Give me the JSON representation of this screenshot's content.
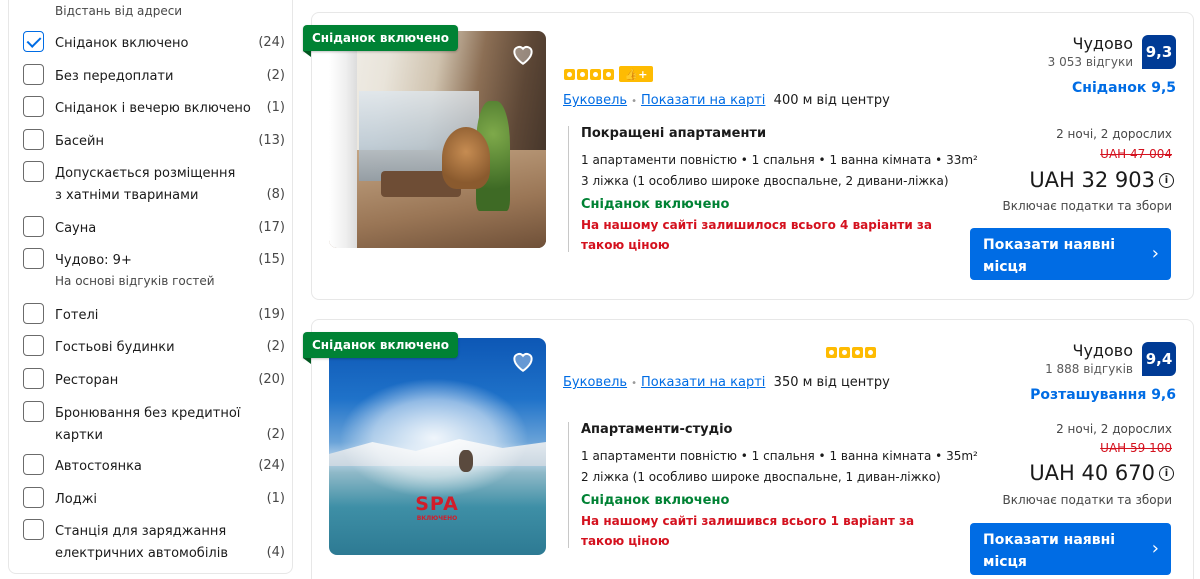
{
  "sidebar": {
    "header": "Відстань від адреси",
    "filters": [
      {
        "label": "Сніданок включено",
        "count": "(24)",
        "checked": true
      },
      {
        "label": "Без передоплати",
        "count": "(2)",
        "checked": false
      },
      {
        "label": "Сніданок і вечерю включено",
        "count": "(1)",
        "checked": false
      },
      {
        "label": "Басейн",
        "count": "(13)",
        "checked": false
      },
      {
        "label": "Допускається розміщення з хатніми тваринами",
        "count": "(8)",
        "checked": false
      },
      {
        "label": "Сауна",
        "count": "(17)",
        "checked": false
      },
      {
        "label": "Чудово: 9+",
        "count": "(15)",
        "checked": false,
        "sub": "На основі відгуків гостей"
      },
      {
        "label": "Готелі",
        "count": "(19)",
        "checked": false
      },
      {
        "label": "Гостьові будинки",
        "count": "(2)",
        "checked": false
      },
      {
        "label": "Ресторан",
        "count": "(20)",
        "checked": false
      },
      {
        "label": "Бронювання без кредитної картки",
        "count": "(2)",
        "checked": false
      },
      {
        "label": "Автостоянка",
        "count": "(24)",
        "checked": false
      },
      {
        "label": "Лоджі",
        "count": "(1)",
        "checked": false
      },
      {
        "label": "Станція для заряджання електричних автомобілів",
        "count": "(4)",
        "checked": false
      }
    ]
  },
  "listings": [
    {
      "ribbon": "Сніданок включено",
      "stars": 4,
      "thumb_badge": "👍+",
      "location_link": "Буковель",
      "map_link": "Показати на карті",
      "distance": "400 м від центру",
      "room_name": "Покращені апартаменти",
      "room_line1": "1 апартаменти повністю • 1 спальня • 1 ванна кімната • 33m²",
      "room_line2": "3 ліжка (1 особливо широке двоспальне, 2 дивани-ліжка)",
      "breakfast": "Сніданок включено",
      "scarcity": "На нашому сайті залишилося всього 4 варіанти за такою ціною",
      "score_word": "Чудово",
      "reviews": "3 053 відгуки",
      "score": "9,3",
      "subscore": "Сніданок 9,5",
      "nights": "2 ночі, 2 дорослих",
      "old_price": "UAH 47 004",
      "price": "UAH 32 903",
      "taxes": "Включає податки та збори",
      "button": "Показати наявні місця"
    },
    {
      "ribbon": "Сніданок включено",
      "stars": 4,
      "location_link": "Буковель",
      "map_link": "Показати на карті",
      "distance": "350 м від центру",
      "room_name": "Апартаменти-студіо",
      "room_line1": "1 апартаменти повністю • 1 спальня • 1 ванна кімната • 35m²",
      "room_line2": "2 ліжка (1 особливо широке двоспальне, 1 диван-ліжко)",
      "breakfast": "Сніданок включено",
      "scarcity": "На нашому сайті залишився всього 1 варіант за такою ціною",
      "score_word": "Чудово",
      "reviews": "1 888 відгуків",
      "score": "9,4",
      "subscore": "Розташування 9,6",
      "nights": "2 ночі, 2 дорослих",
      "old_price": "UAH 59 100",
      "price": "UAH 40 670",
      "taxes": "Включає податки та збори",
      "button": "Показати наявні місця",
      "spa_text": "SPA",
      "spa_sub": "ВКЛЮЧЕНО"
    }
  ],
  "icons": {
    "check": "check-icon",
    "heart": "heart-icon",
    "info": "info-icon",
    "chevron": "chevron-right-icon"
  },
  "colors": {
    "accent": "#006ce4",
    "score_bg": "#003b95",
    "ribbon_green": "#008234",
    "price_red": "#d4111e",
    "star_yellow": "#febb02"
  }
}
